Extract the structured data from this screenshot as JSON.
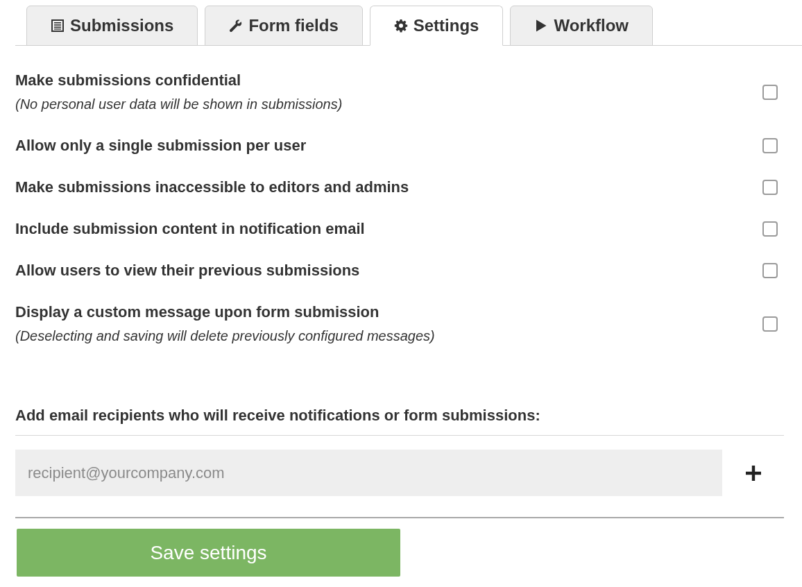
{
  "tabs": [
    {
      "label": "Submissions",
      "selected": false
    },
    {
      "label": "Form fields",
      "selected": false
    },
    {
      "label": "Settings",
      "selected": true
    },
    {
      "label": "Workflow",
      "selected": false
    }
  ],
  "settings": [
    {
      "label": "Make submissions confidential",
      "note": "(No personal user data will be shown in submissions)",
      "checked": false
    },
    {
      "label": "Allow only a single submission per user",
      "checked": false
    },
    {
      "label": "Make submissions inaccessible to editors and admins",
      "checked": false
    },
    {
      "label": "Include submission content in notification email",
      "checked": false
    },
    {
      "label": "Allow users to view their previous submissions",
      "checked": false
    },
    {
      "label": "Display a custom message upon form submission",
      "note": "(Deselecting and saving will delete previously configured messages)",
      "checked": false
    }
  ],
  "recipients": {
    "label": "Add email recipients who will receive notifications or form submissions:",
    "placeholder": "recipient@yourcompany.com"
  },
  "save_button": "Save settings"
}
